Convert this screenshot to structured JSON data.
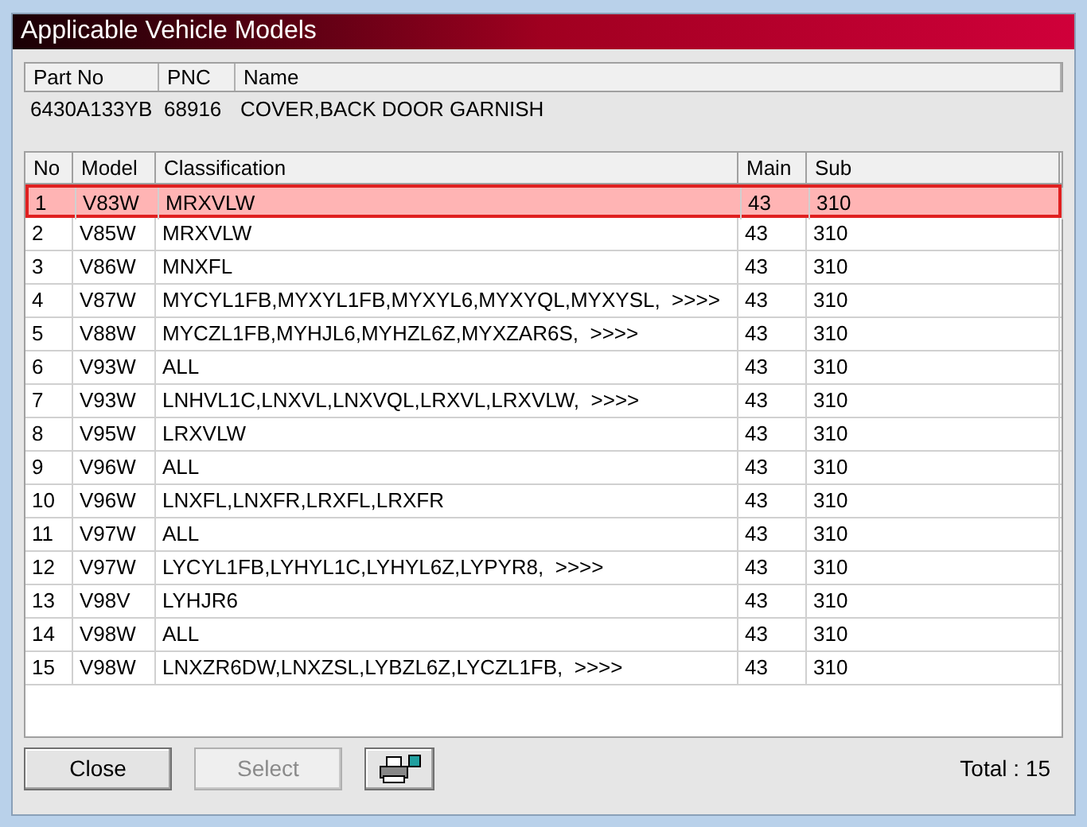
{
  "window": {
    "title": "Applicable Vehicle Models"
  },
  "part": {
    "columns": [
      "Part No",
      "PNC",
      "Name"
    ],
    "values": [
      "6430A133YB",
      "68916",
      "COVER,BACK DOOR GARNISH"
    ]
  },
  "table": {
    "columns": [
      "No",
      "Model",
      "Classification",
      "Main",
      "Sub"
    ],
    "rows": [
      {
        "cells": [
          "1",
          "V83W",
          "MRXVLW",
          "43",
          "310"
        ],
        "selected": true
      },
      {
        "cells": [
          "2",
          "V85W",
          "MRXVLW",
          "43",
          "310"
        ],
        "selected": false
      },
      {
        "cells": [
          "3",
          "V86W",
          "MNXFL",
          "43",
          "310"
        ],
        "selected": false
      },
      {
        "cells": [
          "4",
          "V87W",
          "MYCYL1FB,MYXYL1FB,MYXYL6,MYXYQL,MYXYSL,  >>>>",
          "43",
          "310"
        ],
        "selected": false
      },
      {
        "cells": [
          "5",
          "V88W",
          "MYCZL1FB,MYHJL6,MYHZL6Z,MYXZAR6S,  >>>>",
          "43",
          "310"
        ],
        "selected": false
      },
      {
        "cells": [
          "6",
          "V93W",
          "ALL",
          "43",
          "310"
        ],
        "selected": false
      },
      {
        "cells": [
          "7",
          "V93W",
          "LNHVL1C,LNXVL,LNXVQL,LRXVL,LRXVLW,  >>>>",
          "43",
          "310"
        ],
        "selected": false
      },
      {
        "cells": [
          "8",
          "V95W",
          "LRXVLW",
          "43",
          "310"
        ],
        "selected": false
      },
      {
        "cells": [
          "9",
          "V96W",
          "ALL",
          "43",
          "310"
        ],
        "selected": false
      },
      {
        "cells": [
          "10",
          "V96W",
          "LNXFL,LNXFR,LRXFL,LRXFR",
          "43",
          "310"
        ],
        "selected": false
      },
      {
        "cells": [
          "11",
          "V97W",
          "ALL",
          "43",
          "310"
        ],
        "selected": false
      },
      {
        "cells": [
          "12",
          "V97W",
          "LYCYL1FB,LYHYL1C,LYHYL6Z,LYPYR8,  >>>>",
          "43",
          "310"
        ],
        "selected": false
      },
      {
        "cells": [
          "13",
          "V98V",
          "LYHJR6",
          "43",
          "310"
        ],
        "selected": false
      },
      {
        "cells": [
          "14",
          "V98W",
          "ALL",
          "43",
          "310"
        ],
        "selected": false
      },
      {
        "cells": [
          "15",
          "V98W",
          "LNXZR6DW,LNXZSL,LYBZL6Z,LYCZL1FB,  >>>>",
          "43",
          "310"
        ],
        "selected": false
      }
    ]
  },
  "buttons": [
    {
      "label": "Close",
      "kind": "text",
      "disabled": false
    },
    {
      "label": "Select",
      "kind": "text",
      "disabled": true
    },
    {
      "kind": "print"
    }
  ],
  "status": "Total : 15"
}
